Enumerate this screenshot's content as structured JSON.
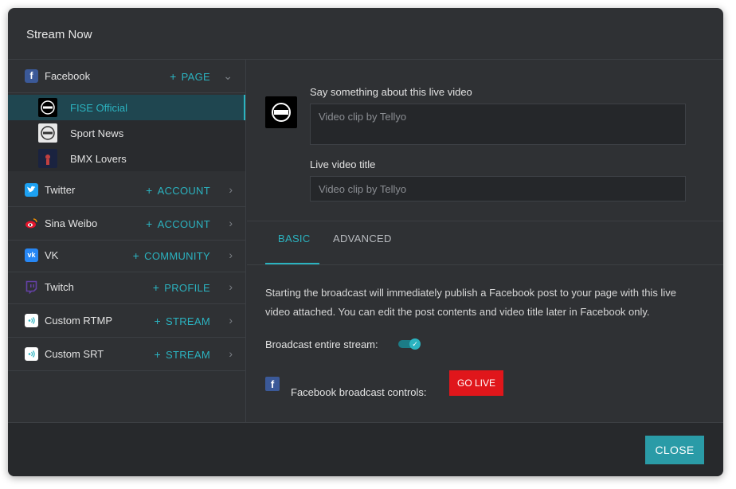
{
  "dialog": {
    "title": "Stream Now"
  },
  "sidebar": {
    "services": [
      {
        "name": "Facebook",
        "action": "PAGE",
        "icon": "facebook-icon",
        "color": "#3b5998",
        "expanded": true
      },
      {
        "name": "Twitter",
        "action": "ACCOUNT",
        "icon": "twitter-icon",
        "color": "#1da1f2"
      },
      {
        "name": "Sina Weibo",
        "action": "ACCOUNT",
        "icon": "weibo-icon",
        "color": "#e6162d"
      },
      {
        "name": "VK",
        "action": "COMMUNITY",
        "icon": "vk-icon",
        "color": "#4a76a8"
      },
      {
        "name": "Twitch",
        "action": "PROFILE",
        "icon": "twitch-icon",
        "color": "#6441a5"
      },
      {
        "name": "Custom RTMP",
        "action": "STREAM",
        "icon": "broadcast-icon",
        "color": "#ffffff"
      },
      {
        "name": "Custom SRT",
        "action": "STREAM",
        "icon": "broadcast-icon",
        "color": "#ffffff"
      }
    ],
    "pages": [
      {
        "name": "FISE Official",
        "selected": true
      },
      {
        "name": "Sport News",
        "selected": false
      },
      {
        "name": "BMX Lovers",
        "selected": false
      }
    ],
    "plus": "+"
  },
  "main": {
    "description_label": "Say something about this live video",
    "description_placeholder": "Video clip by Tellyo",
    "title_label": "Live video title",
    "title_placeholder": "Video clip by Tellyo",
    "tabs": [
      {
        "label": "BASIC",
        "active": true
      },
      {
        "label": "ADVANCED",
        "active": false
      }
    ],
    "info_text": "Starting the broadcast will immediately publish a Facebook post to your page with this live video attached. You can edit the post contents and video title later in Facebook only.",
    "broadcast_entire_label": "Broadcast entire stream:",
    "broadcast_entire_on": true,
    "controls_label": "Facebook broadcast controls:",
    "go_live_label": "GO LIVE"
  },
  "footer": {
    "close_label": "CLOSE"
  },
  "colors": {
    "accent": "#2bb3c0",
    "go_live": "#e0161b",
    "background": "#2f3134"
  }
}
